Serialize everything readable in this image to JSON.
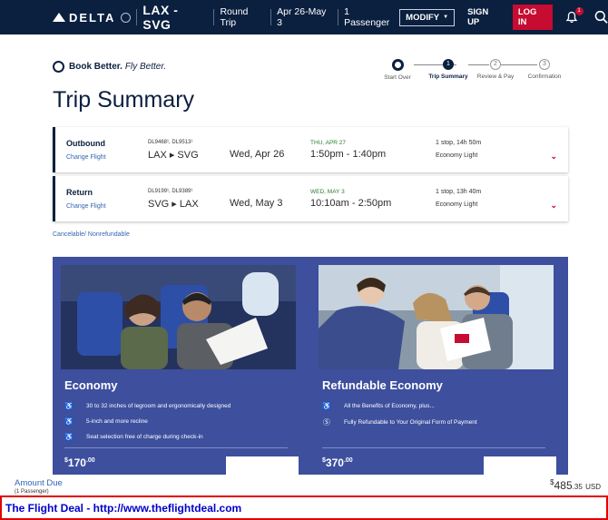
{
  "header": {
    "logo": "DELTA",
    "route": "LAX - SVG",
    "trip_type": "Round Trip",
    "dates": "Apr 26-May 3",
    "passengers": "1 Passenger",
    "modify": "MODIFY",
    "sign_up": "SIGN UP",
    "log_in": "LOG IN",
    "notification_count": "1"
  },
  "book_better": {
    "bold": "Book Better.",
    "italic": "Fly Better."
  },
  "progress": {
    "steps": [
      {
        "num": "",
        "label": "Start Over"
      },
      {
        "num": "1",
        "label": "Trip Summary"
      },
      {
        "num": "2",
        "label": "Review & Pay"
      },
      {
        "num": "3",
        "label": "Confirmation"
      }
    ],
    "active_index": 1
  },
  "page_title": "Trip Summary",
  "flights": [
    {
      "direction": "Outbound",
      "change": "Change Flight",
      "flight_numbers": "DL9468¹, DL9513¹",
      "route": "LAX ▸ SVG",
      "date": "Wed, Apr 26",
      "day_label": "THU, APR 27",
      "time": "1:50pm - 1:40pm",
      "stops": "1 stop, 14h 50m",
      "cabin": "Economy Light"
    },
    {
      "direction": "Return",
      "change": "Change Flight",
      "flight_numbers": "DL9199¹, DL9389¹",
      "route": "SVG ▸ LAX",
      "date": "Wed, May 3",
      "day_label": "WED, MAY 3",
      "time": "10:10am - 2:50pm",
      "stops": "1 stop, 13h 40m",
      "cabin": "Economy Light"
    }
  ],
  "cancel_policy": "Cancelable/ Nonrefundable",
  "cabins": [
    {
      "name": "Economy",
      "features": [
        "30 to 32 inches of legroom and ergonomically designed",
        "5-inch and more recline",
        "Seat selection free of charge during check-in"
      ],
      "price_whole": "170",
      "price_cents": ".00",
      "currency_symbol": "$"
    },
    {
      "name": "Refundable Economy",
      "features": [
        "All the Benefits of Economy, plus...",
        "Fully Refundable to Your Original Form of Payment"
      ],
      "price_whole": "370",
      "price_cents": ".00",
      "currency_symbol": "$"
    }
  ],
  "amount_due": {
    "label": "Amount Due",
    "passengers": "(1 Passenger)",
    "symbol": "$",
    "whole": "485",
    "cents": ".35",
    "currency": "USD"
  },
  "deal_banner": "The Flight Deal - http://www.theflightdeal.com"
}
